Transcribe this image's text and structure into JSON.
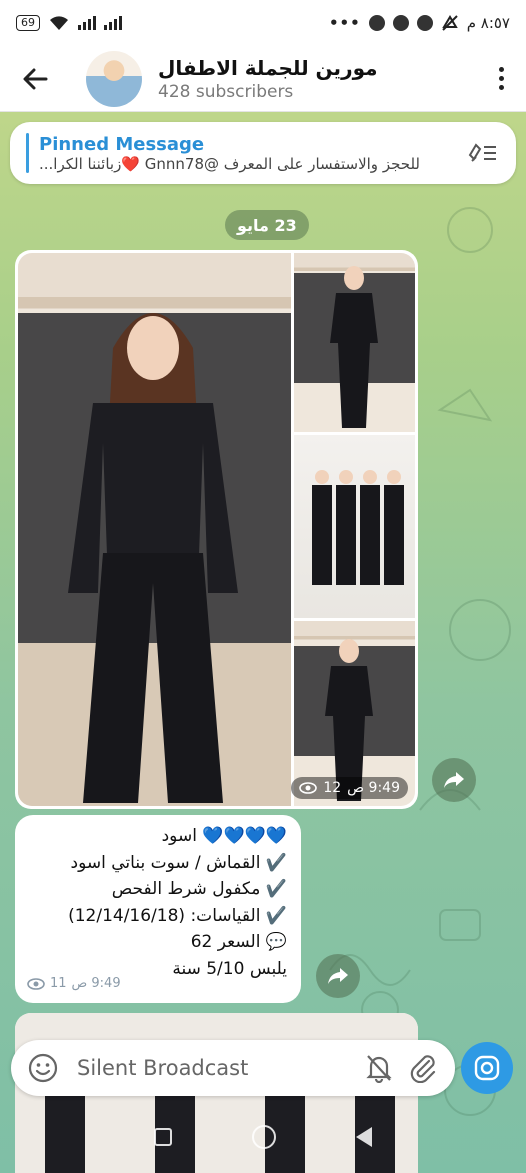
{
  "status_bar": {
    "time": "٨:٥٧ م",
    "battery": "69"
  },
  "header": {
    "title": "مورين للجملة الاطفال",
    "subscribers": "428 subscribers"
  },
  "pinned": {
    "title": "Pinned Message",
    "preview": "للحجز والاستفسار على المعرف @Gnnn78 ❤️زبائننا الكرا..."
  },
  "date_badge": "23 مايو",
  "album": {
    "views": "12",
    "time": "9:49 ص"
  },
  "message": {
    "lines": [
      "💙💙💙💙 اسود",
      "✔️ القماش / سوت بناتي اسود",
      "✔️ مكفول شرط الفحص",
      "✔️ القياسات: (12/14/16/18)",
      "💬 السعر 62",
      "يلبس 5/10 سنة"
    ],
    "views": "11",
    "time": "9:49 ص"
  },
  "input": {
    "placeholder": "Silent Broadcast"
  },
  "icons": {
    "back": "arrow-left-icon",
    "menu": "more-vertical-icon",
    "pin_list": "pin-list-icon",
    "share": "share-icon",
    "eye": "eye-icon",
    "emoji": "emoji-icon",
    "mute": "bell-off-icon",
    "attach": "paperclip-icon",
    "camera": "camera-icon"
  },
  "colors": {
    "accent": "#2e9ae4",
    "pin_title": "#2a8fd6"
  }
}
